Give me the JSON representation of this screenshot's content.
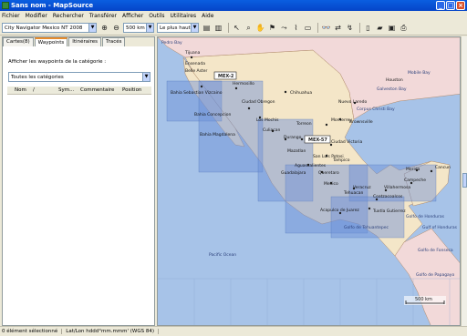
{
  "window": {
    "title": "Sans nom - MapSource"
  },
  "menu": [
    "Fichier",
    "Modifier",
    "Rechercher",
    "Transférer",
    "Afficher",
    "Outils",
    "Utilitaires",
    "Aide"
  ],
  "toolbar": {
    "product": "City Navigator Mexico NT 2008",
    "zoom_scale": "500 km",
    "detail": "Le plus haut"
  },
  "tabs": [
    "Cartes(8)",
    "Waypoints",
    "Itinéraires",
    "Tracés"
  ],
  "active_tab": "Waypoints",
  "waypoints_panel": {
    "category_label": "Afficher les waypoints de la catégorie :",
    "category_value": "Toutes les catégories",
    "columns": [
      "Nom",
      "/",
      "Sym...",
      "Commentaire",
      "Position"
    ]
  },
  "map": {
    "water_labels": [
      "Pedro Bay",
      "Mobile Bay",
      "Galveston Bay",
      "Corpus Christi Bay",
      "Pacific Ocean",
      "Golfo de Tehuantepec",
      "Golfo de Honduras",
      "Golfo de Fonseca",
      "Golfo de Papagayo",
      "Gulf of Honduras"
    ],
    "city_labels": [
      "Tijuana",
      "Ensenada",
      "Belle Aster",
      "Hermosillo",
      "Chihuahua",
      "Bahia Sebastian Vizcaino",
      "Ciudad Obregon",
      "Bahia Concepcion",
      "Los Mochis",
      "Culiacan",
      "Bahia Magdalena",
      "Mazatlan",
      "Torreon",
      "Monterrey",
      "Nuevo Laredo",
      "Brownsville",
      "Ciudad Victoria",
      "Durango",
      "San Luis Potosi",
      "Tampico",
      "Aguascalientes",
      "Queretaro",
      "Guadalajara",
      "Mexico",
      "Veracruz",
      "Coatzacoalcos",
      "Villahermosa",
      "Merida",
      "Cancun",
      "Campeche",
      "Acapulco de Juarez",
      "Tuxtla Gutierrez",
      "Tehuacan",
      "Houston"
    ],
    "map_tiles": [
      "MEX-2",
      "MEX-57"
    ],
    "scale_label": "500 km"
  },
  "status": {
    "selection": "0 élément sélectionné",
    "format": "Lat/Lon hddd°mm.mmm' (WGS 84)"
  }
}
